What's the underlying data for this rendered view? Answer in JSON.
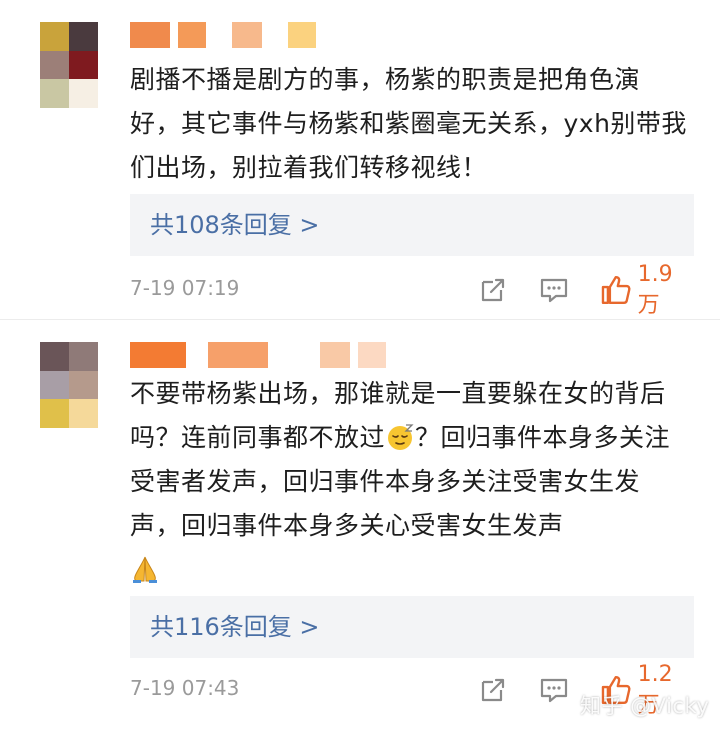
{
  "colors": {
    "accent": "#e7682d",
    "link": "#4a6fa5",
    "reply_bg": "#f3f4f6",
    "meta_gray": "#9a9a9a"
  },
  "comments": [
    {
      "text": "剧播不播是剧方的事，杨紫的职责是把角色演好，其它事件与杨紫和紫圈毫无关系，yxh别带我们出场，别拉着我们转移视线！",
      "replies_label": "共108条回复 >",
      "time": "7-19 07:19",
      "like_count": "1.9万",
      "avatar_icon": "mosaic-avatar",
      "avatar_colors": [
        "#c9a33b",
        "#4a3a3e",
        "#9c7f78",
        "#7f1a1f",
        "#c9c7a3",
        "#f6efe4"
      ],
      "name_colors": [
        "#f08a4c",
        "#f49a58",
        "#f7b98c",
        "#fbd27f"
      ]
    },
    {
      "text_before_emoji": "不要带杨紫出场，那谁就是一直要躲在女的背后吗？连前同事都不放过",
      "emoji_icon": "sleepy-face-emoji",
      "text_after_emoji": "？回归事件本身多关注受害者发声，回归事件本身多关注受害女生发声，回归事件本身多关心受害女生发声",
      "trailing_emoji_icon": "folded-hands-emoji",
      "replies_label": "共116条回复 >",
      "time": "7-19 07:43",
      "like_count": "1.2万",
      "avatar_icon": "mosaic-avatar",
      "avatar_colors": [
        "#6a5558",
        "#8f7a78",
        "#a89ea6",
        "#b59a8c",
        "#e0c04a",
        "#f5d99a"
      ],
      "name_colors": [
        "#f37b33",
        "#f6a06a",
        "#f9c9a6",
        "#fcd9c2"
      ]
    }
  ],
  "watermark": "知乎 @Vicky"
}
